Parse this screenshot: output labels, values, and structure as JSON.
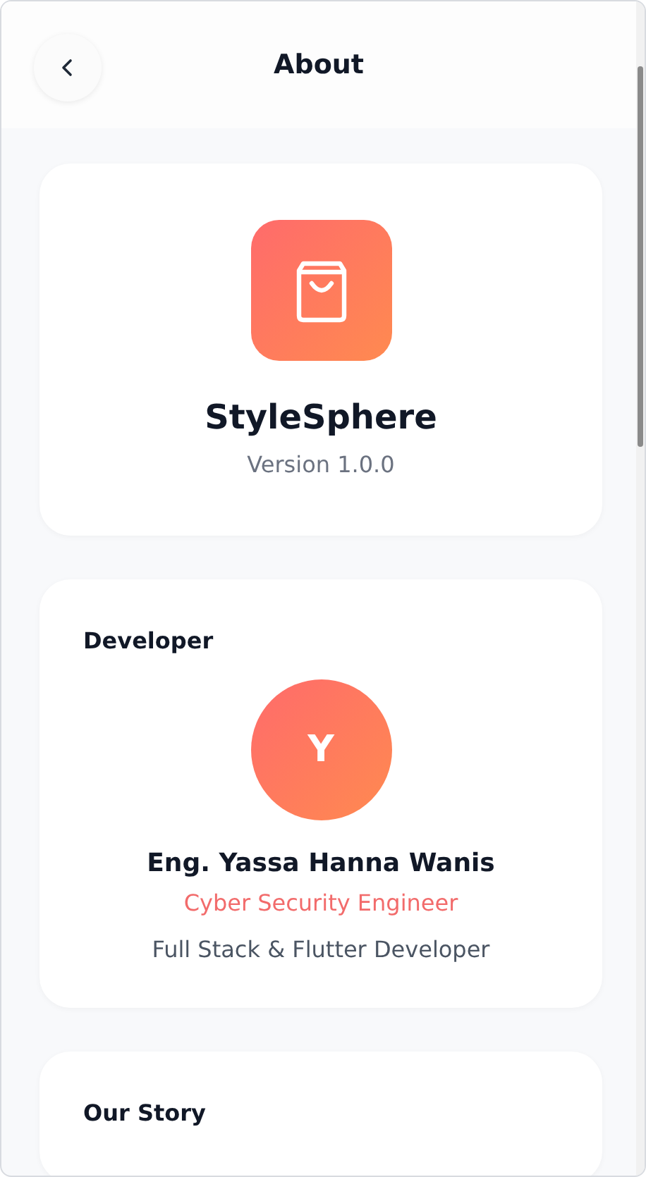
{
  "header": {
    "title": "About"
  },
  "app": {
    "name": "StyleSphere",
    "version": "Version 1.0.0"
  },
  "developer": {
    "heading": "Developer",
    "initial": "Y",
    "name": "Eng. Yassa Hanna Wanis",
    "role": "Cyber Security Engineer",
    "description": "Full Stack & Flutter Developer"
  },
  "story": {
    "heading": "Our Story"
  }
}
